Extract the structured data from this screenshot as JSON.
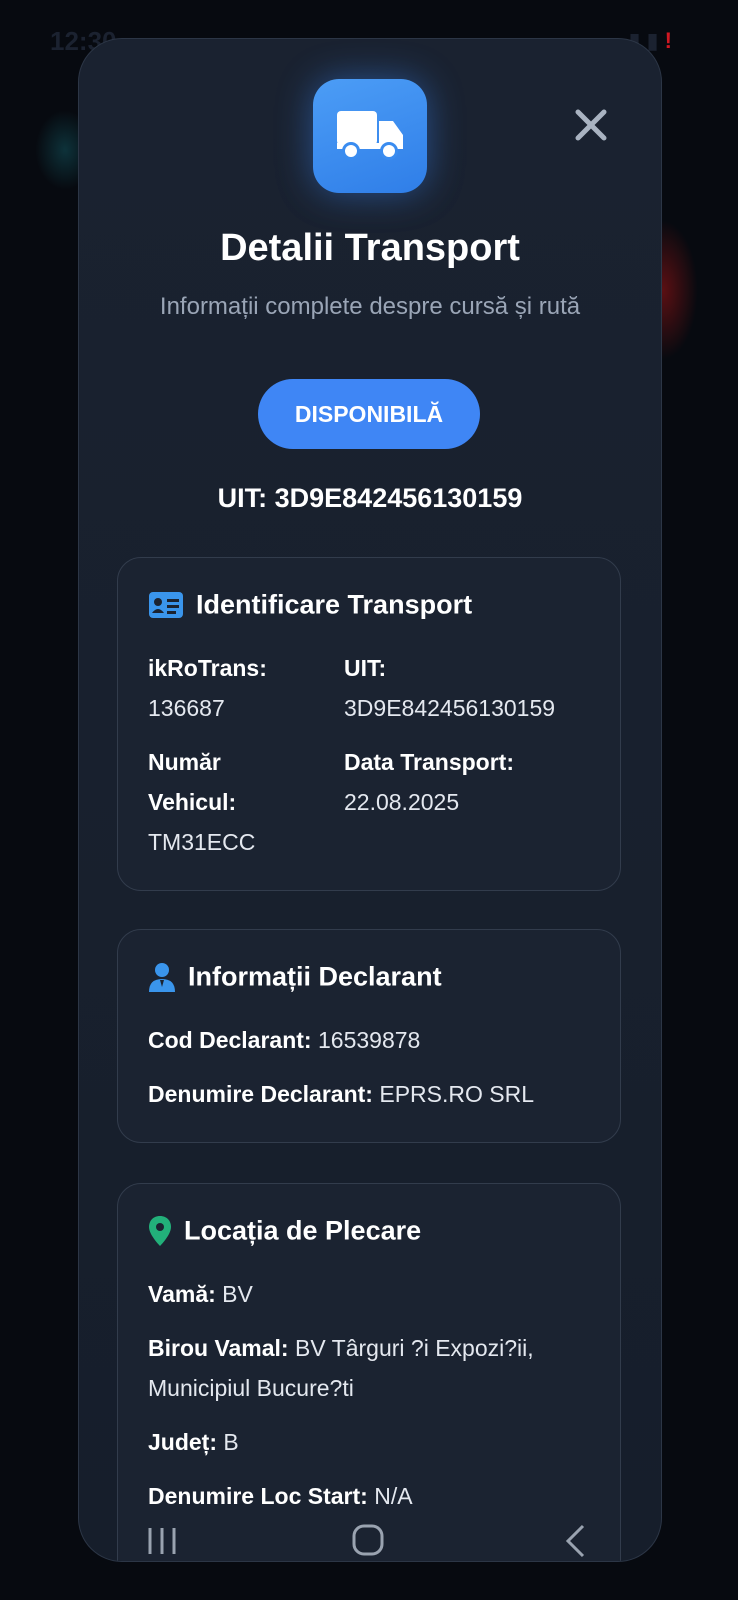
{
  "status_bar": {
    "time": "12:30",
    "icons": [
      "photo-icon",
      "messenger-icon",
      "alert-icon",
      "signal-icon"
    ]
  },
  "modal": {
    "header_icon": "truck-icon",
    "title": "Detalii Transport",
    "subtitle": "Informații complete despre cursă și rută",
    "status_badge": "DISPONIBILĂ",
    "uit_line": "UIT: 3D9E842456130159",
    "close_icon": "close-icon"
  },
  "identificare": {
    "heading": "Identificare Transport",
    "icon": "id-card-icon",
    "ikrotrans_label": "ikRoTrans:",
    "ikrotrans_value": "136687",
    "uit_label": "UIT:",
    "uit_value": "3D9E842456130159",
    "vehicle_label_line1": "Număr",
    "vehicle_label_line2": "Vehicul:",
    "vehicle_value": "TM31ECC",
    "date_label": "Data Transport:",
    "date_value": "22.08.2025"
  },
  "declarant": {
    "heading": "Informații Declarant",
    "icon": "person-icon",
    "cod_label": "Cod Declarant:",
    "cod_value": "16539878",
    "denumire_label": "Denumire Declarant:",
    "denumire_value": "EPRS.RO SRL"
  },
  "plecare": {
    "heading": "Locația de Plecare",
    "icon": "location-pin-icon",
    "vama_label": "Vamă:",
    "vama_value": "BV",
    "birou_label": "Birou Vamal:",
    "birou_value_line1": "BV Târguri ?i Expozi?ii,",
    "birou_value_line2": "Municipiul Bucure?ti",
    "judet_label": "Județ:",
    "judet_value": "B",
    "loc_label": "Denumire Loc Start:",
    "loc_value": "N/A"
  },
  "colors": {
    "accent": "#3f86f5",
    "background": "#1a2230",
    "muted_text": "#9aa5b6",
    "pin_green": "#22b07a"
  }
}
